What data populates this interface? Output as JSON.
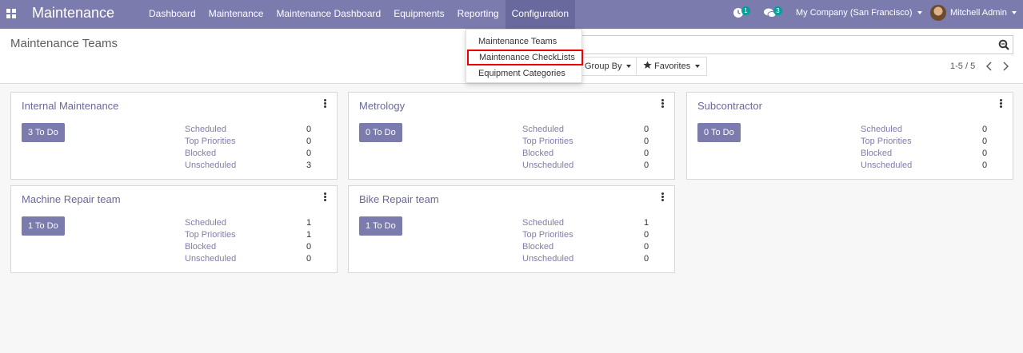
{
  "app": {
    "title": "Maintenance"
  },
  "menu": [
    "Dashboard",
    "Maintenance",
    "Maintenance Dashboard",
    "Equipments",
    "Reporting",
    "Configuration"
  ],
  "systray": {
    "activity_badge": "1",
    "messages_badge": "3",
    "company": "My Company (San Francisco)",
    "user": "Mitchell Admin"
  },
  "page": {
    "title": "Maintenance Teams"
  },
  "controls": {
    "group_by": "Group By",
    "favorites": "Favorites",
    "pager": "1-5 / 5"
  },
  "config_dropdown": [
    "Maintenance Teams",
    "Maintenance CheckLists",
    "Equipment Categories"
  ],
  "stat_labels": [
    "Scheduled",
    "Top Priorities",
    "Blocked",
    "Unscheduled"
  ],
  "teams": [
    {
      "name": "Internal Maintenance",
      "todo": "3 To Do",
      "stats": [
        "0",
        "0",
        "0",
        "3"
      ]
    },
    {
      "name": "Metrology",
      "todo": "0 To Do",
      "stats": [
        "0",
        "0",
        "0",
        "0"
      ]
    },
    {
      "name": "Subcontractor",
      "todo": "0 To Do",
      "stats": [
        "0",
        "0",
        "0",
        "0"
      ]
    },
    {
      "name": "Machine Repair team",
      "todo": "1 To Do",
      "stats": [
        "1",
        "1",
        "0",
        "0"
      ]
    },
    {
      "name": "Bike Repair team",
      "todo": "1 To Do",
      "stats": [
        "1",
        "0",
        "0",
        "0"
      ]
    }
  ],
  "colors": {
    "navbar": "#7c7bad",
    "accent": "#7c7bad",
    "badge": "#00a09d",
    "highlight": "#e00000"
  }
}
